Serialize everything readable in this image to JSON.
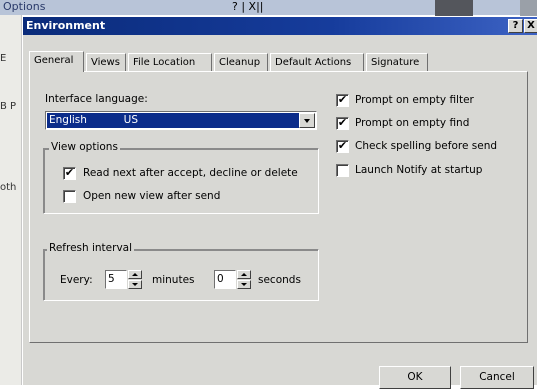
{
  "background": {
    "window_title": "Options",
    "title_buttons": "? | X||",
    "side_labels": [
      "E",
      "B P",
      "oth"
    ]
  },
  "dialog": {
    "title": "Environment",
    "help_button": "?",
    "close_button": "X",
    "tabs": [
      {
        "label": "General",
        "active": true
      },
      {
        "label": "Views",
        "active": false
      },
      {
        "label": "File Location",
        "active": false
      },
      {
        "label": "Cleanup",
        "active": false
      },
      {
        "label": "Default Actions",
        "active": false
      },
      {
        "label": "Signature",
        "active": false
      }
    ],
    "interface_language": {
      "label": "Interface language:",
      "value": "English           US"
    },
    "view_options": {
      "legend": "View options",
      "items": [
        {
          "label": "Read next after accept, decline or delete",
          "checked": true
        },
        {
          "label": "Open new view after send",
          "checked": false
        }
      ]
    },
    "refresh_interval": {
      "legend": "Refresh interval",
      "every_label": "Every:",
      "minutes_value": "5",
      "minutes_label": "minutes",
      "seconds_value": "0",
      "seconds_label": "seconds"
    },
    "right_options": [
      {
        "label": "Prompt on empty filter",
        "checked": true
      },
      {
        "label": "Prompt on empty find",
        "checked": true
      },
      {
        "label": "Check spelling before send",
        "checked": true
      },
      {
        "label": "Launch Notify at startup",
        "checked": false
      }
    ],
    "ok_label": "OK",
    "cancel_label": "Cancel",
    "check_glyph": "✔"
  },
  "colors": {
    "title_bar": "#0a2b7a",
    "selection": "#0b2c8a",
    "dialog_face": "#d8d8d4"
  }
}
